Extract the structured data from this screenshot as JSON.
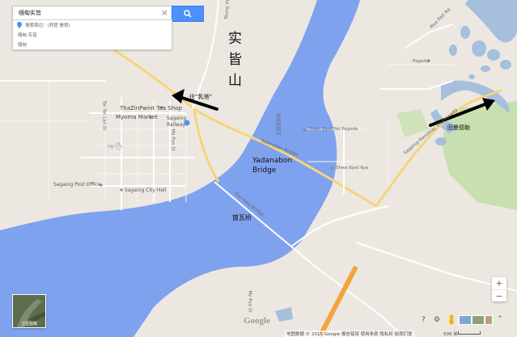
{
  "search": {
    "query": "缅甸实皆",
    "suggestion_label": "搜索周边：(宾馆 餐馆)",
    "row2": "缅甸 实皆",
    "row3": "缅甸"
  },
  "annotations": {
    "sagaing_vertical": [
      "实",
      "皆",
      "山"
    ],
    "to_pagoda": "往“乳塔”",
    "to_cn": "回曼德勒",
    "yadanabon": [
      "Yadanabon",
      "Bridge"
    ],
    "bridge_cn": "茵瓦桥"
  },
  "map_labels": {
    "tea_shop": "ThaZinPwint Tea Shop",
    "myoma_market": "Myoma Market",
    "sagaing": "Sagaing",
    "railway": "Railway",
    "post_office": "Sagaing Post Office",
    "city_hall": "Sagaing City Hall",
    "market_small": "ဈေး ကြီး",
    "pagoda": "Pagoda",
    "myo_patt_rd": "Myo Patt Rd",
    "shwe_kyat_yat": "Shwe Kyat Yat Pagoda",
    "shwe_kyat_kya": "Shwe Kyat Kya",
    "expressway": "Sagaing-Mandalay Expressway",
    "inwa_bridge": "The Inwa Bridge",
    "yadanabon_road": "Yadanabon Bridge",
    "tauk_yin": "Taung Yin",
    "tar_yat_lan_st": "Tar Yat Lan St",
    "ma_pya_st": "Ma Pya St",
    "river_name": "伊洛瓦底江",
    "my_pya": "My Pya St"
  },
  "controls": {
    "satellite": "卫星图像",
    "zoom_in": "+",
    "zoom_out": "−",
    "google": "Google"
  },
  "footer": {
    "attribution": "地图数据 © 2015 Google   报告错误   使用条款   隐私权   给我们提",
    "scale": "500 米"
  },
  "colors": {
    "land": "#ece8e1",
    "water": "#a5bfdd",
    "river": "#7fa2ef",
    "road_major": "#f5d57a",
    "road_minor": "#ffffff",
    "park": "#c7dfb1",
    "highway_orange": "#f3a43b"
  }
}
